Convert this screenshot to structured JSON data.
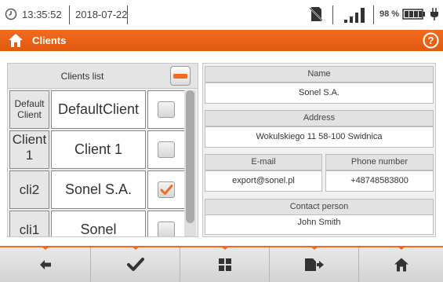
{
  "status_bar": {
    "time": "13:35:52",
    "date": "2018-07-22",
    "battery_percent": "98 %",
    "icons": [
      "clock-icon",
      "no-sd-card-icon",
      "signal-strength-icon",
      "battery-icon",
      "power-plug-icon"
    ]
  },
  "title_bar": {
    "title": "Clients",
    "icons": [
      "home-icon",
      "help-icon"
    ],
    "accent_color": "#f26a1e"
  },
  "clients_list": {
    "header": "Clients list",
    "rows": [
      {
        "id": "Default\nClient",
        "name": "DefaultClient",
        "checked": false
      },
      {
        "id": "Client\n1",
        "name": "Client 1",
        "checked": false
      },
      {
        "id": "cli2",
        "name": "Sonel S.A.",
        "checked": true
      },
      {
        "id": "cli1",
        "name": "Sonel",
        "checked": false
      }
    ]
  },
  "details": {
    "name_label": "Name",
    "name_value": "Sonel S.A.",
    "address_label": "Address",
    "address_value": "Wokulskiego 11 58-100 Swidnica",
    "email_label": "E-mail",
    "email_value": "export@sonel.pl",
    "phone_label": "Phone number",
    "phone_value": "+48748583800",
    "contact_label": "Contact person",
    "contact_value": "John Smith"
  },
  "toolbar": {
    "buttons": [
      "back-arrow-icon",
      "confirm-check-icon",
      "grid-icon",
      "memory-card-export-icon",
      "home-icon"
    ]
  }
}
